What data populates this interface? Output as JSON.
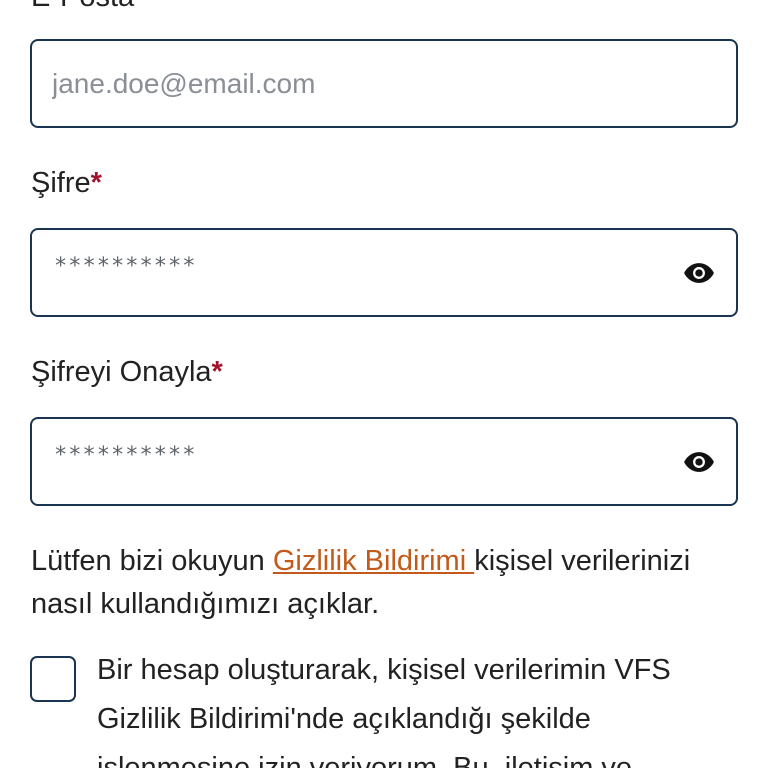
{
  "email": {
    "label": "E-Posta",
    "placeholder": "jane.doe@email.com"
  },
  "password": {
    "label": "Şifre",
    "required_mark": "*",
    "masked_value": "**********",
    "toggle_icon": "eye-icon"
  },
  "confirm_password": {
    "label": "Şifreyi Onayla",
    "required_mark": "*",
    "masked_value": "**********",
    "toggle_icon": "eye-icon"
  },
  "notice": {
    "prefix": "Lütfen bizi okuyun ",
    "link_text": "Gizlilik Bildirimi ",
    "suffix": "kişisel verilerinizi nasıl kullandığımızı açıklar."
  },
  "consent": {
    "checked": false,
    "text": "Bir hesap oluşturarak, kişisel verilerimin VFS Gizlilik Bildirimi'nde açıklandığı şekilde işlenmesine izin veriyorum. Bu, iletişim ve"
  },
  "colors": {
    "border": "#1a3552",
    "required": "#a3122b",
    "link": "#c15a1b",
    "text": "#222222"
  }
}
